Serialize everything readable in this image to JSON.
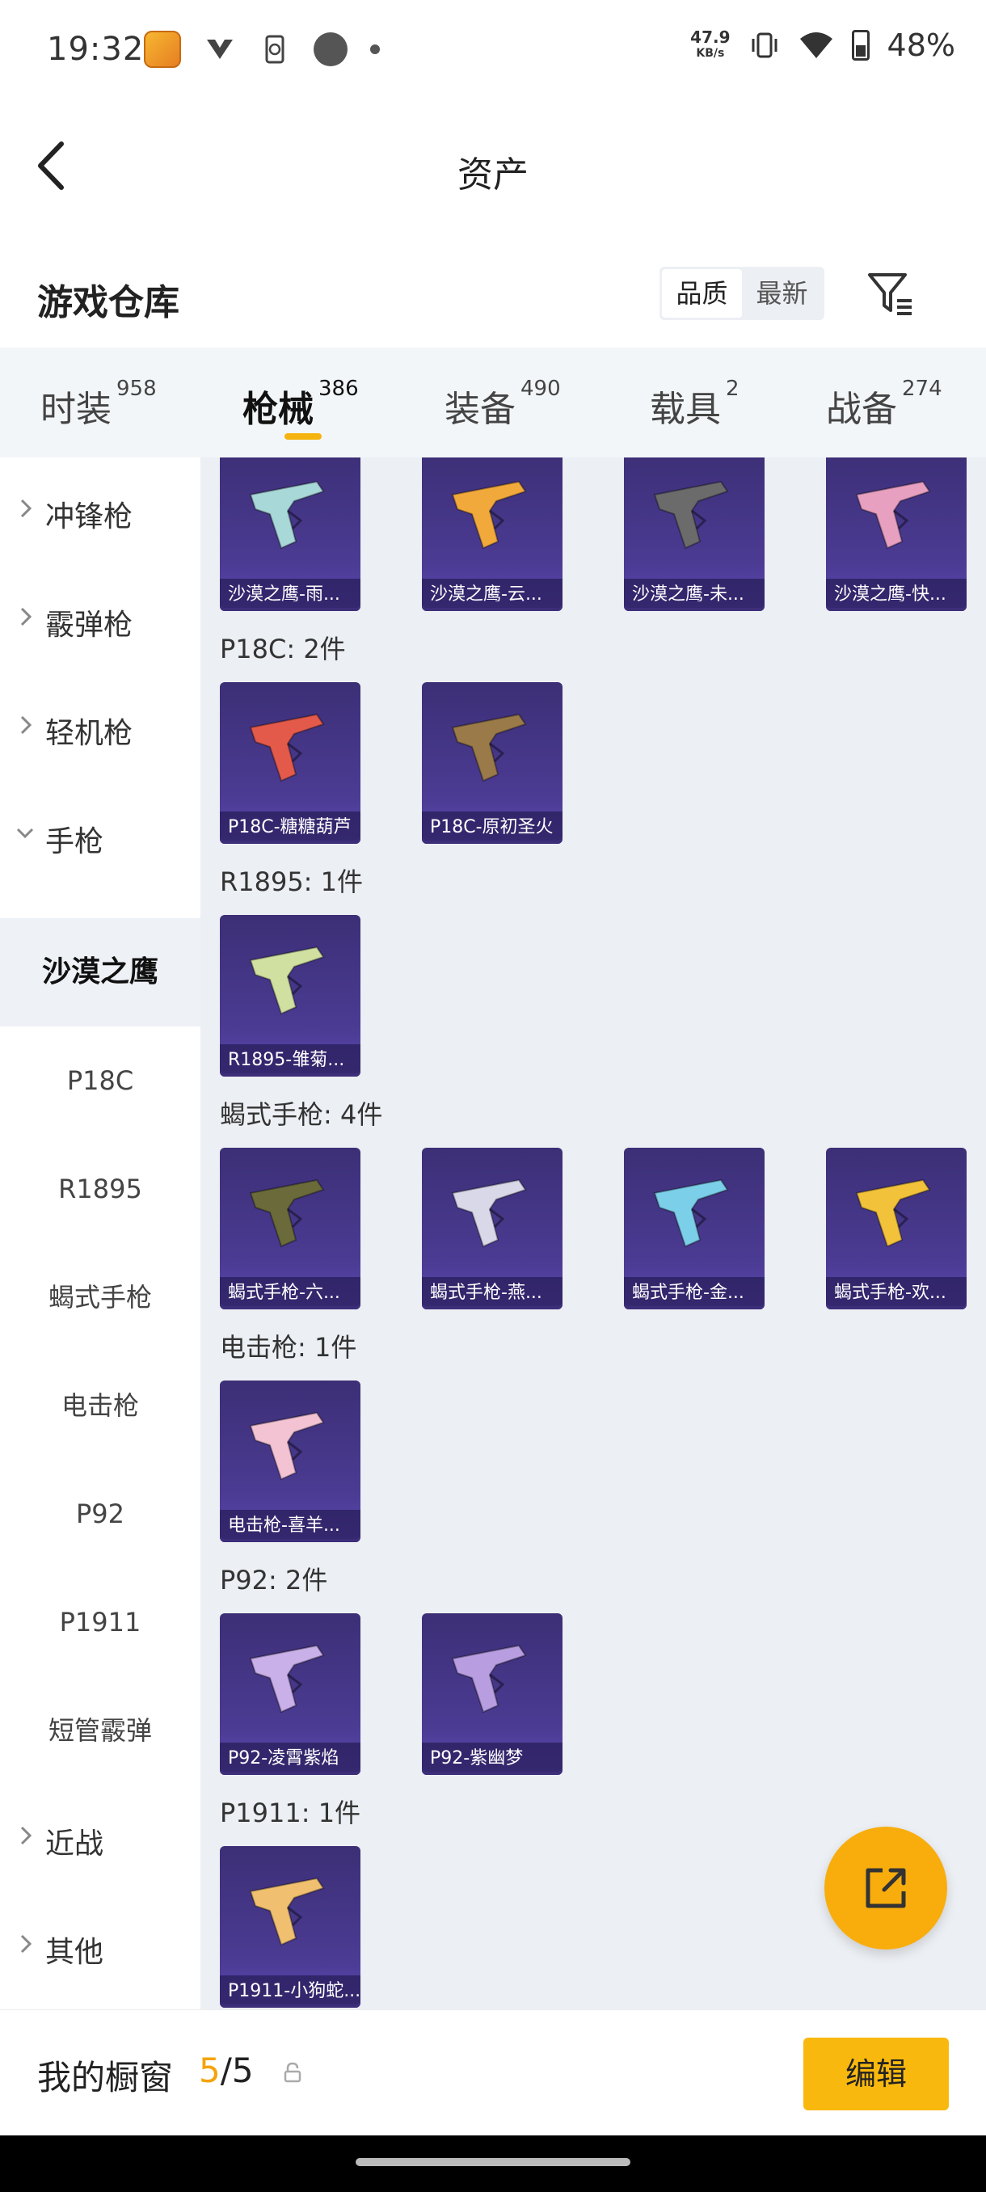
{
  "status_bar": {
    "time": "19:32",
    "net_speed_value": "47.9",
    "net_speed_unit": "KB/s",
    "battery": "48%"
  },
  "header": {
    "title": "资产",
    "back_icon": "chevron-left-icon"
  },
  "section": {
    "title": "游戏仓库",
    "sort_options": [
      "品质",
      "最新"
    ],
    "sort_selected": "品质",
    "filter_icon": "filter-icon"
  },
  "tabs": [
    {
      "label": "时装",
      "count": "958",
      "active": false
    },
    {
      "label": "枪械",
      "count": "386",
      "active": true
    },
    {
      "label": "装备",
      "count": "490",
      "active": false
    },
    {
      "label": "载具",
      "count": "2",
      "active": false
    },
    {
      "label": "战备",
      "count": "274",
      "active": false
    }
  ],
  "sidebar": {
    "categories": [
      {
        "label": "冲锋枪",
        "expanded": false
      },
      {
        "label": "霰弹枪",
        "expanded": false
      },
      {
        "label": "轻机枪",
        "expanded": false
      },
      {
        "label": "手枪",
        "expanded": true
      }
    ],
    "sub_items": [
      {
        "label": "沙漠之鹰",
        "active": true
      },
      {
        "label": "P18C",
        "active": false
      },
      {
        "label": "R1895",
        "active": false
      },
      {
        "label": "蝎式手枪",
        "active": false
      },
      {
        "label": "电击枪",
        "active": false
      },
      {
        "label": "P92",
        "active": false
      },
      {
        "label": "P1911",
        "active": false
      },
      {
        "label": "短管霰弹",
        "active": false
      }
    ],
    "bottom_categories": [
      {
        "label": "近战",
        "expanded": false
      },
      {
        "label": "其他",
        "expanded": false
      }
    ]
  },
  "groups": [
    {
      "title": "",
      "items": [
        "沙漠之鹰-雨...",
        "沙漠之鹰-云...",
        "沙漠之鹰-未...",
        "沙漠之鹰-快..."
      ]
    },
    {
      "title": "P18C: 2件",
      "items": [
        "P18C-糖糖葫芦",
        "P18C-原初圣火"
      ]
    },
    {
      "title": "R1895: 1件",
      "items": [
        "R1895-雏菊..."
      ]
    },
    {
      "title": "蝎式手枪: 4件",
      "items": [
        "蝎式手枪-六...",
        "蝎式手枪-燕...",
        "蝎式手枪-金...",
        "蝎式手枪-欢..."
      ]
    },
    {
      "title": "电击枪: 1件",
      "items": [
        "电击枪-喜羊..."
      ]
    },
    {
      "title": "P92: 2件",
      "items": [
        "P92-凌霄紫焰",
        "P92-紫幽梦"
      ]
    },
    {
      "title": "P1911: 1件",
      "items": [
        "P1911-小狗蛇..."
      ]
    }
  ],
  "item_colors": {
    "沙漠之鹰-雨...": "#a8d8d8",
    "沙漠之鹰-云...": "#f2a93b",
    "沙漠之鹰-未...": "#6b6b6b",
    "沙漠之鹰-快...": "#e8a0c0",
    "P18C-糖糖葫芦": "#e45a4a",
    "P18C-原初圣火": "#9a7a48",
    "R1895-雏菊...": "#cfe0a0",
    "蝎式手枪-六...": "#6a6a3a",
    "蝎式手枪-燕...": "#d8d8e8",
    "蝎式手枪-金...": "#7ccfe8",
    "蝎式手枪-欢...": "#f2c23a",
    "电击枪-喜羊...": "#f3c3d3",
    "P92-凌霄紫焰": "#c9b0e8",
    "P92-紫幽梦": "#b89ee0",
    "P1911-小狗蛇...": "#f0c070"
  },
  "showcase": {
    "label": "我的橱窗",
    "current": "5",
    "total": "/5",
    "lock_icon": "lock-icon",
    "edit_label": "编辑"
  },
  "fab": {
    "icon": "share-external-icon"
  }
}
